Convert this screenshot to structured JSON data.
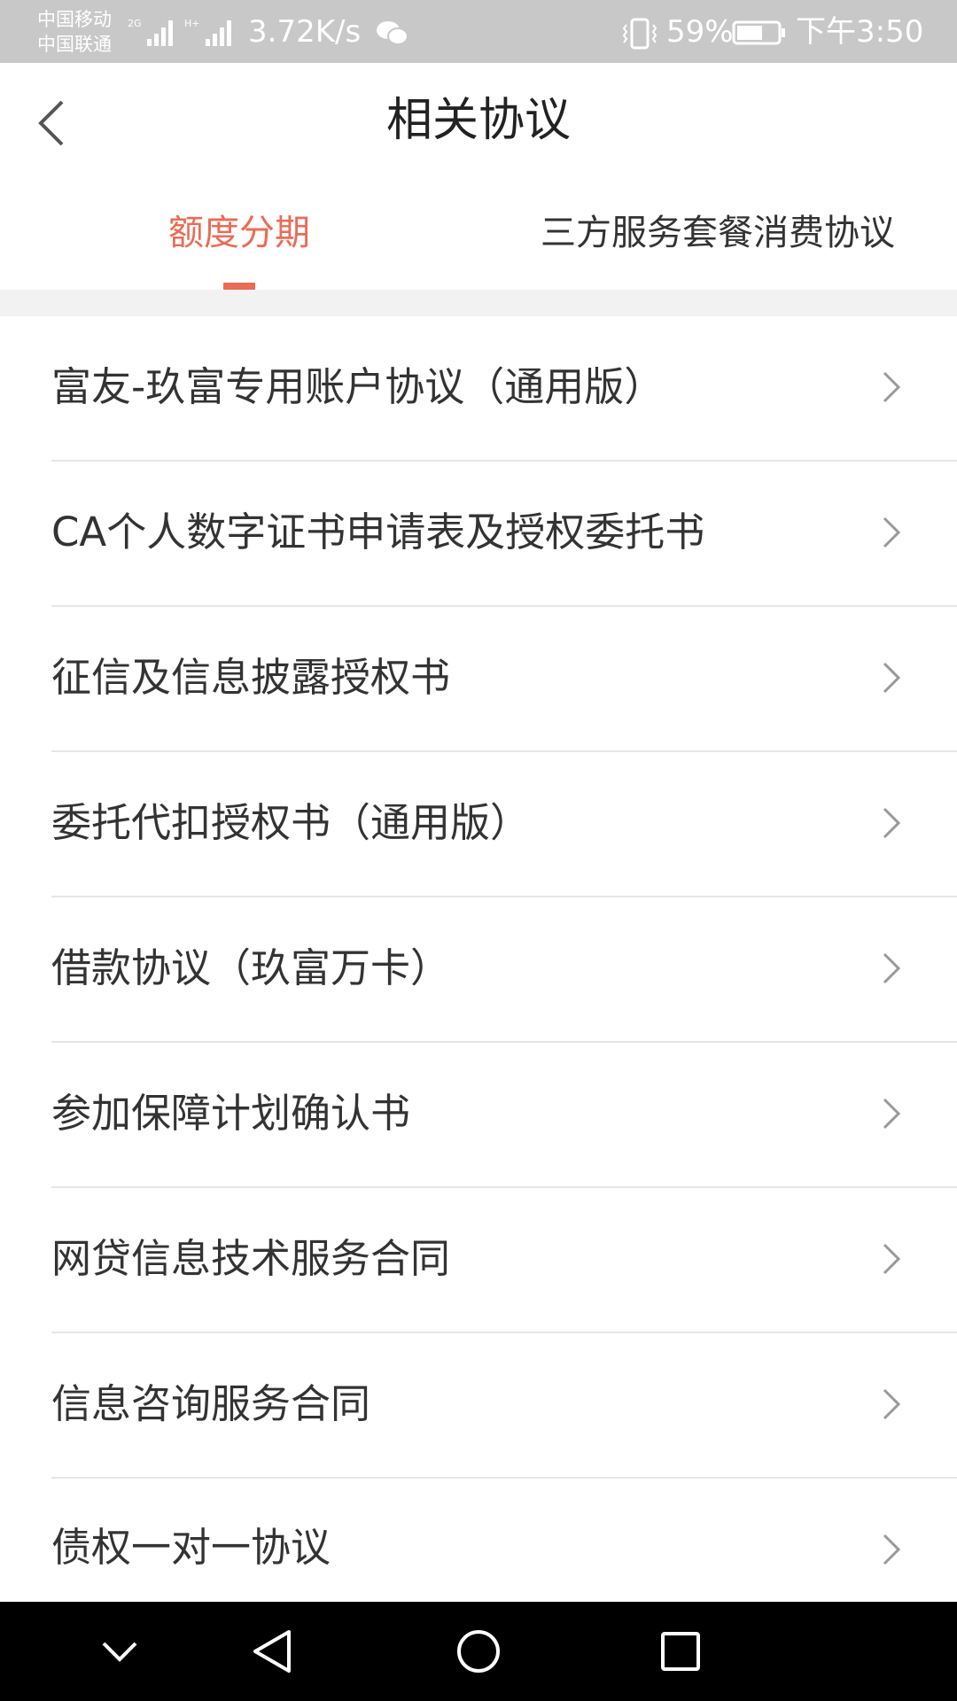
{
  "status_bar": {
    "carrier_1": "中国移动",
    "carrier_2": "中国联通",
    "net_speed": "3.72K/s",
    "battery": "59%",
    "time": "下午3:50",
    "icons": [
      "signal-2g-icon",
      "signal-hplus-icon",
      "wechat-icon",
      "vibrate-icon",
      "battery-icon"
    ]
  },
  "header": {
    "title": "相关协议",
    "back_icon": "chevron-left-icon"
  },
  "tabs": [
    {
      "label": "额度分期",
      "active": true
    },
    {
      "label": "三方服务套餐消费协议",
      "active": false
    }
  ],
  "agreements": [
    "富友-玖富专用账户协议（通用版）",
    "CA个人数字证书申请表及授权委托书",
    "征信及信息披露授权书",
    "委托代扣授权书（通用版）",
    "借款协议（玖富万卡）",
    "参加保障计划确认书",
    "网贷信息技术服务合同",
    "信息咨询服务合同",
    "债权一对一协议"
  ],
  "colors": {
    "accent": "#e96c57",
    "status_bar_bg": "#c8c8c8",
    "divider": "#e6e6e6",
    "nav_bar_bg": "#000000"
  },
  "nav_bar": {
    "icons": [
      "hide-keyboard-icon",
      "back-triangle-icon",
      "home-circle-icon",
      "recent-apps-icon"
    ]
  }
}
